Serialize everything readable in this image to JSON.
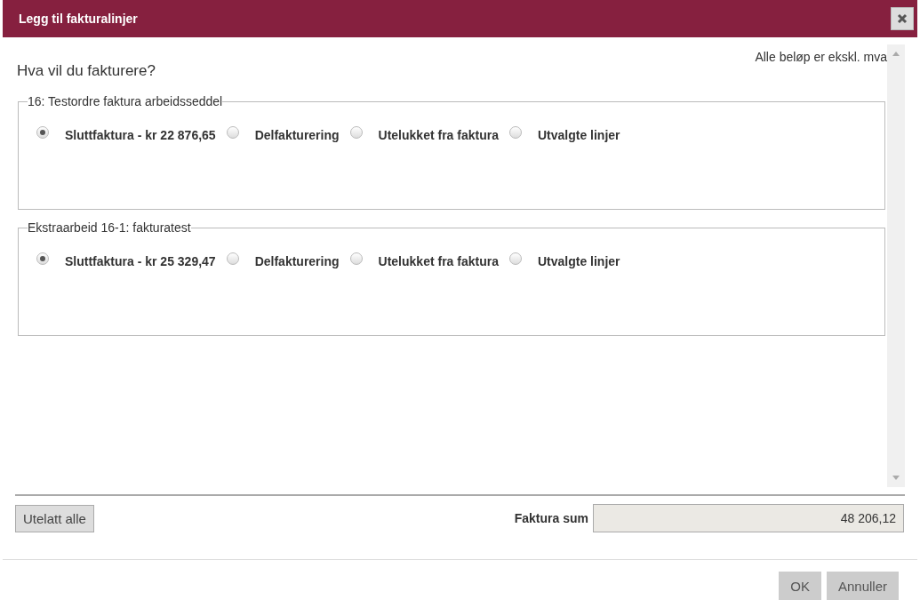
{
  "window": {
    "title": "Legg til fakturalinjer"
  },
  "note": "Alle beløp er ekskl. mva",
  "question": "Hva vil du fakturere?",
  "groups": [
    {
      "title": "16: Testordre faktura arbeidsseddel",
      "options": [
        {
          "label": "Sluttfaktura - kr 22 876,65",
          "selected": true
        },
        {
          "label": "Delfakturering",
          "selected": false
        },
        {
          "label": "Utelukket fra faktura",
          "selected": false
        },
        {
          "label": "Utvalgte linjer",
          "selected": false
        }
      ]
    },
    {
      "title": "Ekstraarbeid 16-1: fakturatest",
      "options": [
        {
          "label": "Sluttfaktura - kr 25 329,47",
          "selected": true
        },
        {
          "label": "Delfakturering",
          "selected": false
        },
        {
          "label": "Utelukket fra faktura",
          "selected": false
        },
        {
          "label": "Utvalgte linjer",
          "selected": false
        }
      ]
    }
  ],
  "exclude_all_button": "Utelatt alle",
  "total": {
    "label": "Faktura sum",
    "value": "48 206,12"
  },
  "buttons": [
    "OK",
    "Annuller"
  ]
}
